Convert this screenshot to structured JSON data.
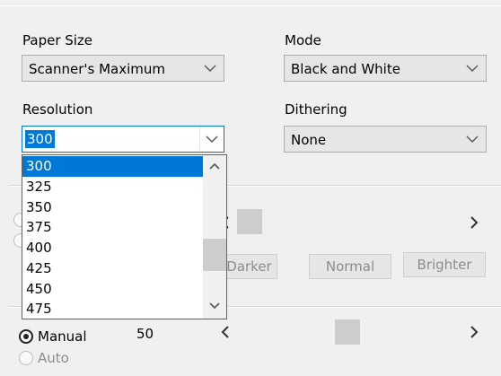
{
  "paper_size": {
    "label": "Paper Size",
    "value": "Scanner's Maximum"
  },
  "mode": {
    "label": "Mode",
    "value": "Black and White"
  },
  "resolution": {
    "label": "Resolution",
    "value": "300",
    "options": [
      "300",
      "325",
      "350",
      "375",
      "400",
      "425",
      "450",
      "475"
    ],
    "selected_index": 0
  },
  "dithering": {
    "label": "Dithering",
    "value": "None"
  },
  "contrast": {
    "darker_label": "Darker",
    "normal_label": "Normal",
    "brighter_label": "Brighter"
  },
  "brightness": {
    "manual_label": "Manual",
    "auto_label": "Auto",
    "value": "50",
    "manual_selected": true
  },
  "icons": {
    "chevron": "chevron-down-icon",
    "left": "scroll-left-icon",
    "right": "scroll-right-icon",
    "up": "chevron-up-icon"
  },
  "colors": {
    "accent": "#0078d7",
    "background": "#f0f0f0"
  }
}
